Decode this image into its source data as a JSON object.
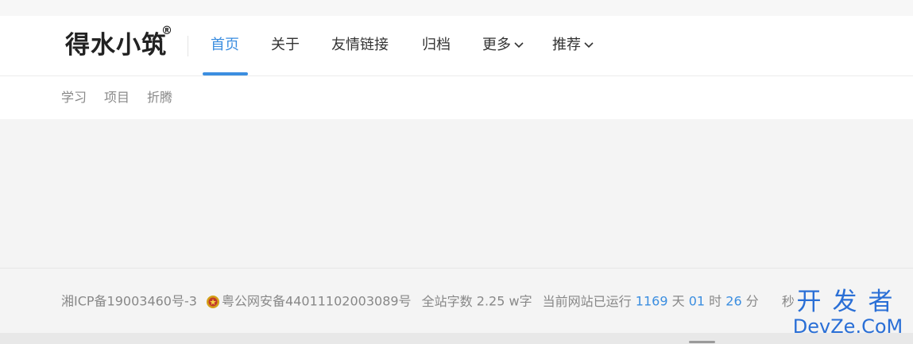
{
  "brand": {
    "logo_text": "得水小筑",
    "registered_mark": "®"
  },
  "nav": {
    "items": [
      {
        "label": "首页",
        "active": true
      },
      {
        "label": "关于"
      },
      {
        "label": "友情链接"
      },
      {
        "label": "归档"
      },
      {
        "label": "更多",
        "has_dropdown": true
      },
      {
        "label": "推荐",
        "has_dropdown": true
      }
    ],
    "accent_color": "#3b8ee0"
  },
  "subnav": {
    "items": [
      "学习",
      "项目",
      "折腾"
    ]
  },
  "footer": {
    "icp": "湘ICP备19003460号-3",
    "police_record": "粤公网安备44011102003089号",
    "word_count_label": "全站字数",
    "word_count_value": "2.25 w字",
    "uptime_label": "当前网站已运行",
    "uptime_days": "1169",
    "days_unit": "天",
    "uptime_hours": "01",
    "hours_unit": "时",
    "uptime_minutes": "26",
    "minutes_unit": "分",
    "seconds_unit": "秒"
  },
  "watermark": {
    "line1": "开发者",
    "line2": "DevZe.CoM"
  }
}
